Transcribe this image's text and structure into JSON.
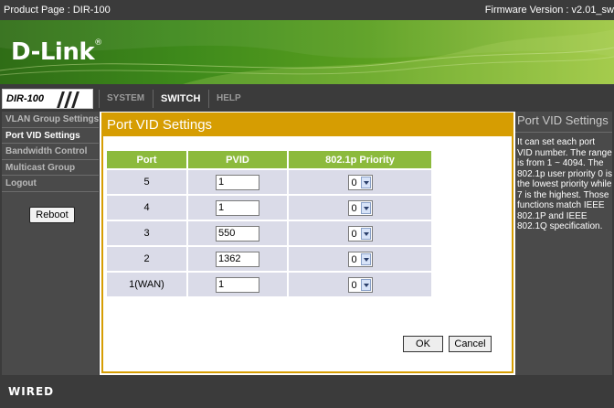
{
  "topbar": {
    "product": "Product Page : DIR-100",
    "firmware": "Firmware Version : v2.01_sw"
  },
  "banner": {
    "logo": "D-Link",
    "logo_mark": "®"
  },
  "nav": {
    "model": "DIR-100",
    "tabs": [
      {
        "label": "SYSTEM",
        "active": false
      },
      {
        "label": "SWITCH",
        "active": true
      },
      {
        "label": "HELP",
        "active": false
      }
    ]
  },
  "sidebar": {
    "items": [
      {
        "label": "VLAN Group Settings",
        "active": false
      },
      {
        "label": "Port VID Settings",
        "active": true
      },
      {
        "label": "Bandwidth Control",
        "active": false
      },
      {
        "label": "Multicast Group",
        "active": false
      },
      {
        "label": "Logout",
        "active": false
      }
    ],
    "reboot_label": "Reboot"
  },
  "main": {
    "title": "Port VID Settings",
    "headers": [
      "Port",
      "PVID",
      "802.1p Priority"
    ],
    "rows": [
      {
        "port": "5",
        "pvid": "1",
        "priority": "0"
      },
      {
        "port": "4",
        "pvid": "1",
        "priority": "0"
      },
      {
        "port": "3",
        "pvid": "550",
        "priority": "0"
      },
      {
        "port": "2",
        "pvid": "1362",
        "priority": "0"
      },
      {
        "port": "1(WAN)",
        "pvid": "1",
        "priority": "0"
      }
    ],
    "ok_label": "OK",
    "cancel_label": "Cancel"
  },
  "help": {
    "title": "Port VID Settings",
    "text": "It can set each port VID number. The range is from 1 ~ 4094. The 802.1p user priority 0 is the lowest priority while 7 is the highest. Those functions match IEEE 802.1P and IEEE 802.1Q specification."
  },
  "footer": {
    "brand": "WIRED"
  },
  "colors": {
    "accent": "#d69d02",
    "table_header": "#8cba3c",
    "table_cell": "#dadbe8",
    "background": "#3b3b3b",
    "panel": "#4a4a4a"
  }
}
